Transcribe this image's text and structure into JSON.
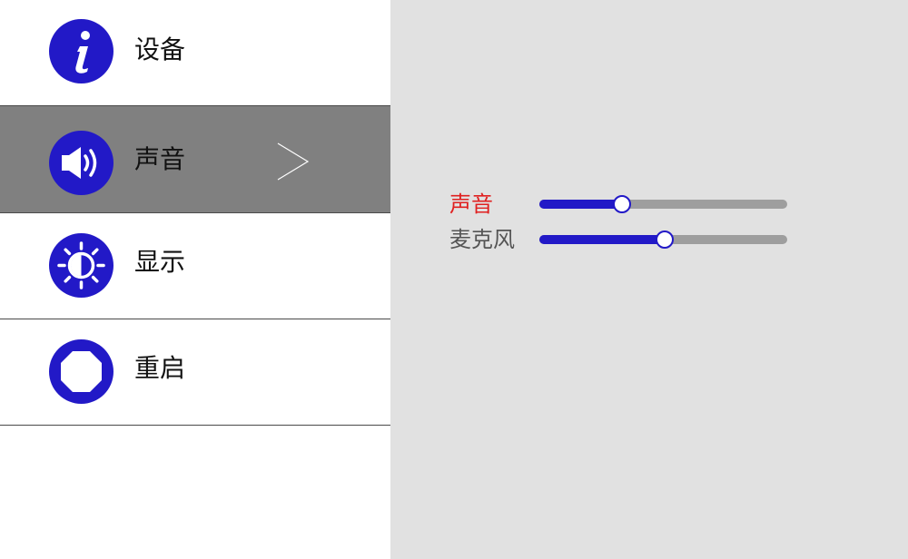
{
  "sidebar": {
    "items": [
      {
        "label": "设备",
        "icon": "info-icon"
      },
      {
        "label": "声音",
        "icon": "speaker-icon"
      },
      {
        "label": "显示",
        "icon": "brightness-icon"
      },
      {
        "label": "重启",
        "icon": "restart-icon"
      }
    ],
    "selected_index": 1
  },
  "sliders": [
    {
      "label": "声音",
      "value": 0.33
    },
    {
      "label": "麦克风",
      "value": 0.5
    }
  ],
  "colors": {
    "accent": "#2219c7",
    "active_label": "#e02020",
    "selected_row": "#808080",
    "panel_bg": "#e1e1e1",
    "track": "#9e9e9e"
  }
}
